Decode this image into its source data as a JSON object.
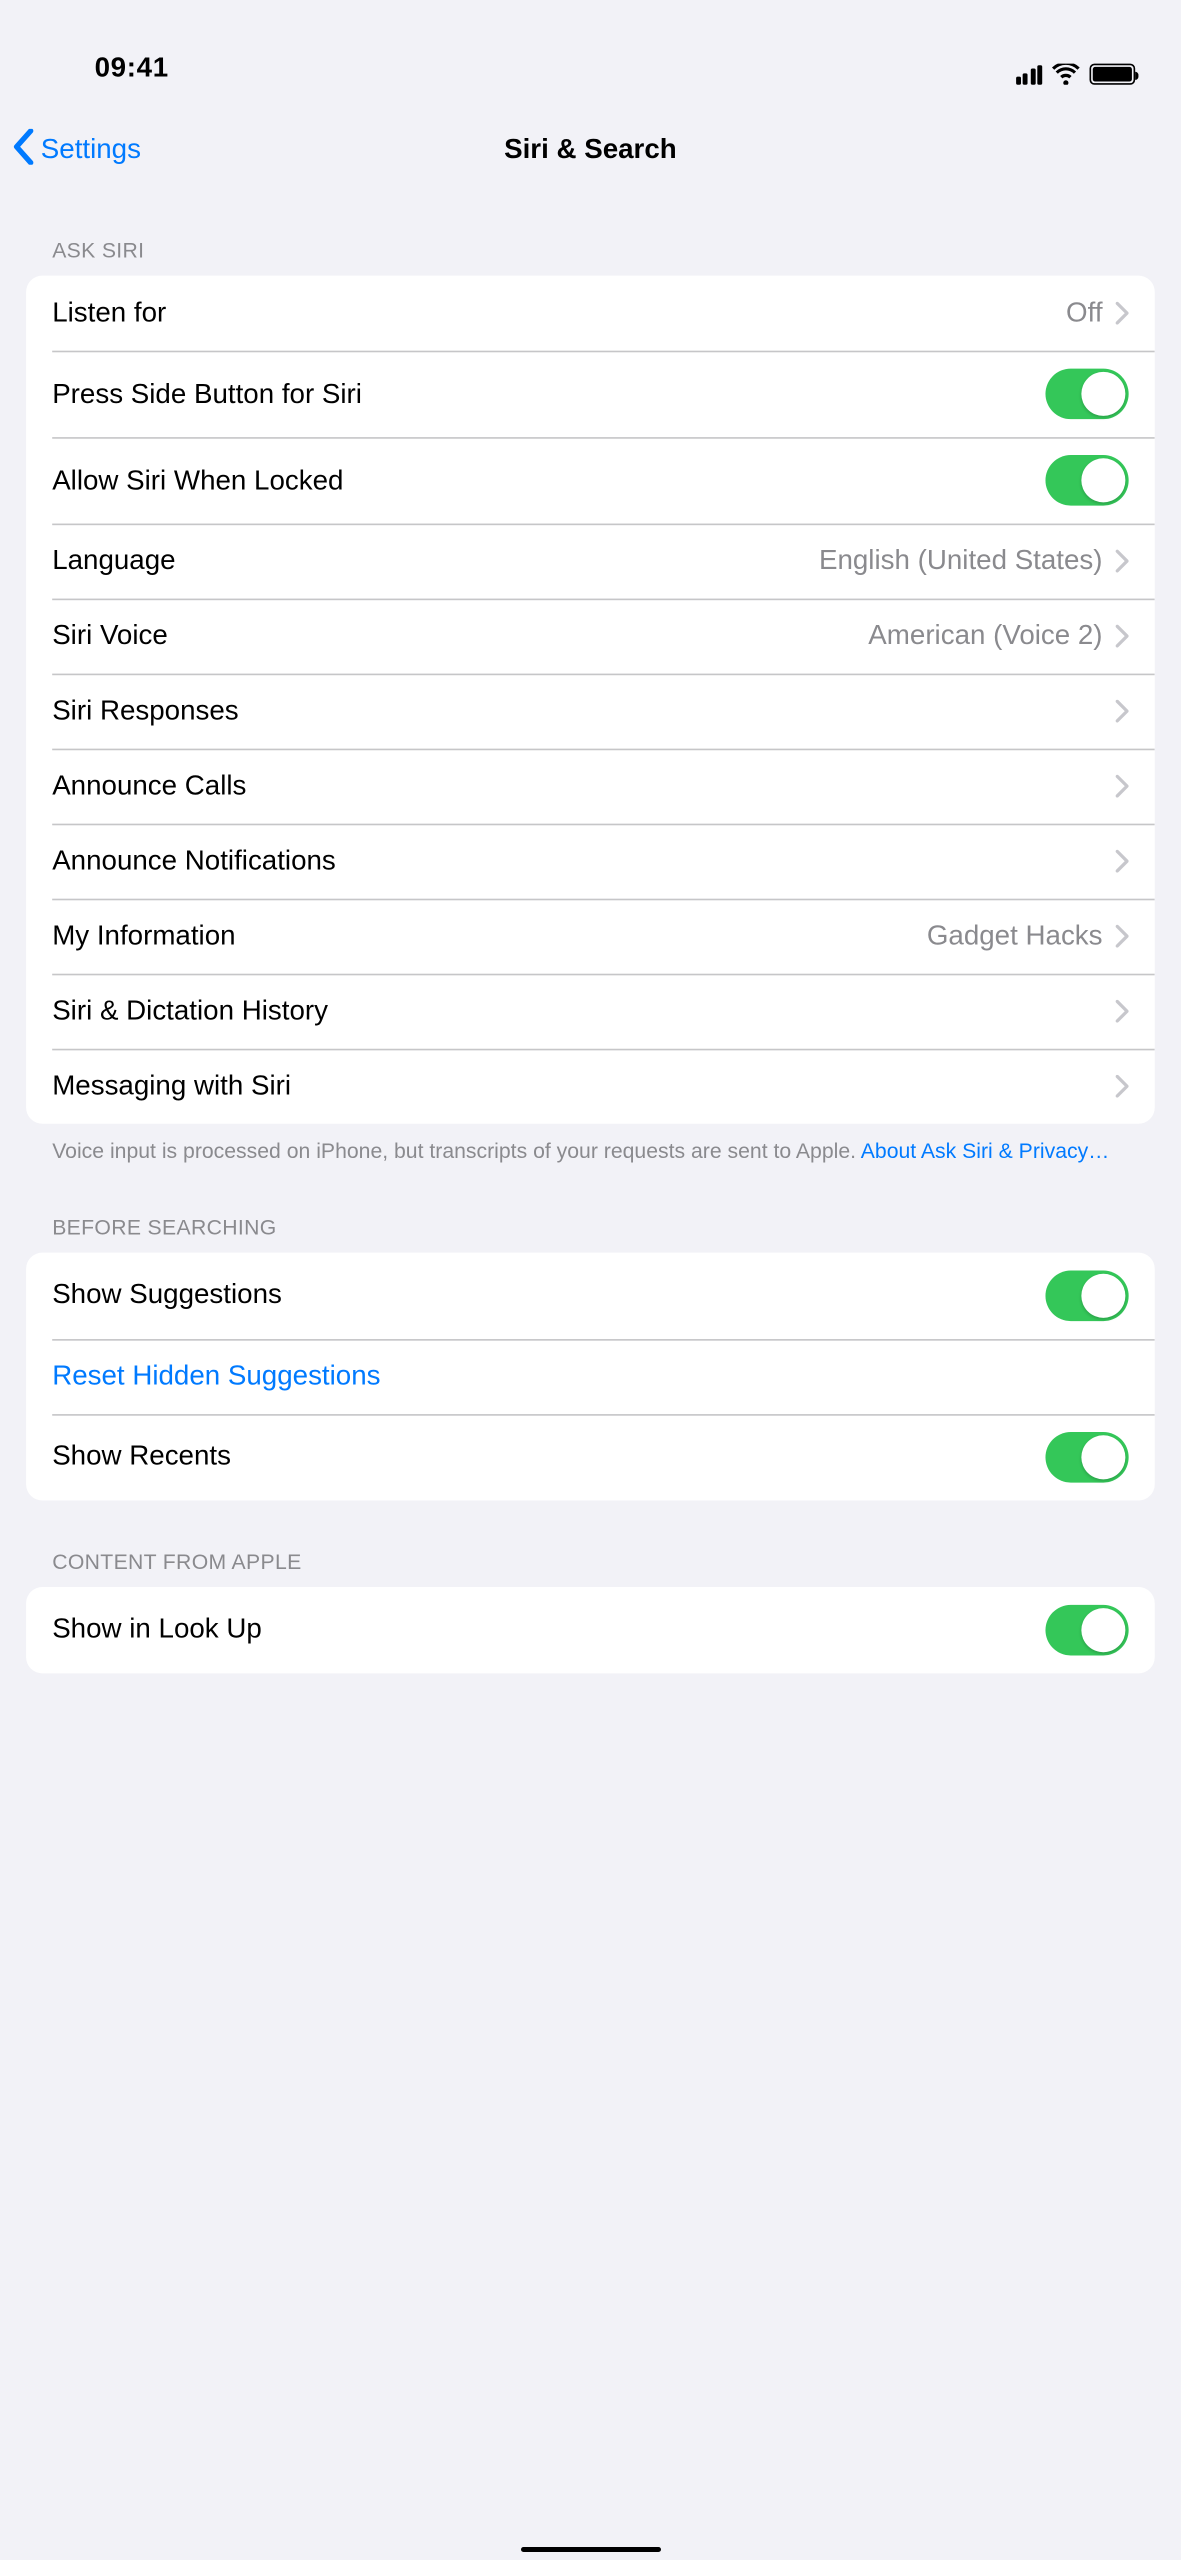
{
  "status": {
    "time": "09:41"
  },
  "nav": {
    "back": "Settings",
    "title": "Siri & Search"
  },
  "sections": {
    "ask_siri": {
      "header": "ASK SIRI",
      "items": [
        {
          "label": "Listen for",
          "value": "Off"
        },
        {
          "label": "Press Side Button for Siri"
        },
        {
          "label": "Allow Siri When Locked"
        },
        {
          "label": "Language",
          "value": "English (United States)"
        },
        {
          "label": "Siri Voice",
          "value": "American (Voice 2)"
        },
        {
          "label": "Siri Responses"
        },
        {
          "label": "Announce Calls"
        },
        {
          "label": "Announce Notifications"
        },
        {
          "label": "My Information",
          "value": "Gadget Hacks"
        },
        {
          "label": "Siri & Dictation History"
        },
        {
          "label": "Messaging with Siri"
        }
      ],
      "footer_text": "Voice input is processed on iPhone, but transcripts of your requests are sent to Apple. ",
      "footer_link": "About Ask Siri & Privacy…"
    },
    "before_searching": {
      "header": "BEFORE SEARCHING",
      "items": [
        {
          "label": "Show Suggestions"
        },
        {
          "label": "Reset Hidden Suggestions"
        },
        {
          "label": "Show Recents"
        }
      ]
    },
    "content_from_apple": {
      "header": "CONTENT FROM APPLE",
      "items": [
        {
          "label": "Show in Look Up"
        }
      ]
    }
  }
}
